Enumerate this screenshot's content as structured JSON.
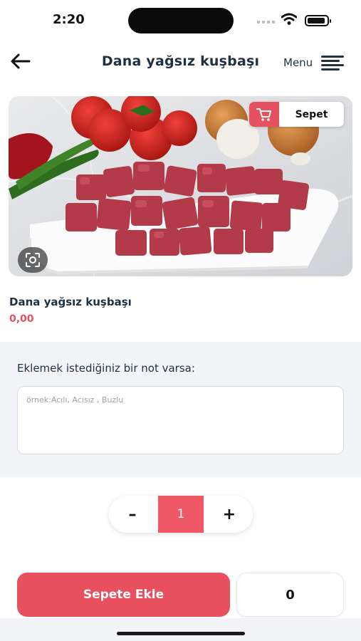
{
  "status_bar": {
    "time": "2:20"
  },
  "header": {
    "title": "Dana yağsız kuşbaşı",
    "menu_label": "Menu"
  },
  "cart_badge": {
    "label": "Sepet"
  },
  "product": {
    "name": "Dana yağsız kuşbaşı",
    "price": "0,00"
  },
  "note": {
    "label": "Eklemek istediğiniz bir not varsa:",
    "placeholder": "örnek:Acılı, Acısız , Buzlu",
    "value": ""
  },
  "quantity": {
    "minus_label": "–",
    "value": "1",
    "plus_label": "+"
  },
  "footer": {
    "add_to_cart_label": "Sepete Ekle",
    "total": "0"
  },
  "colors": {
    "accent": "#e9505e",
    "title": "#1f3140",
    "section_bg": "#f2f4f7"
  }
}
